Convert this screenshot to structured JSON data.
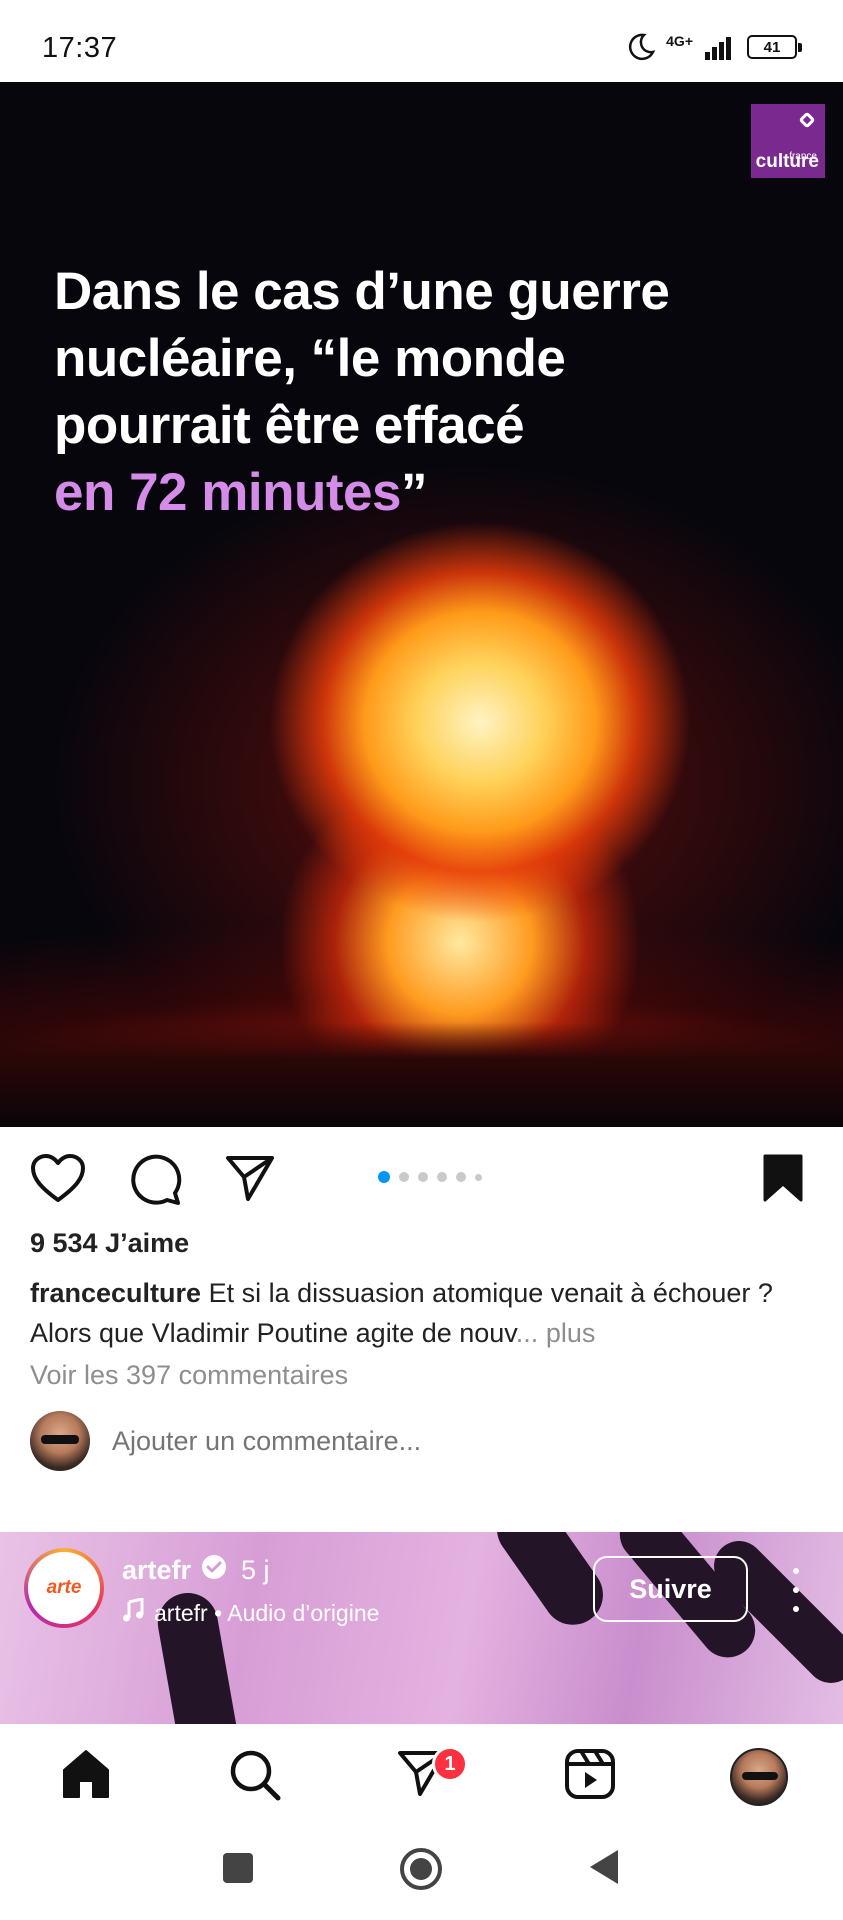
{
  "status_bar": {
    "time": "17:37",
    "network": "4G+",
    "battery": "41"
  },
  "post": {
    "brand_logo": {
      "line1": "france",
      "line2": "culture",
      "color": "#7a2a8e"
    },
    "headline": {
      "line1": "Dans le cas d’une guerre",
      "line2": "nucléaire, “le monde",
      "line3": "pourrait être effacé",
      "accent_line": "en 72 minutes",
      "closing_quote": "”",
      "accent_color": "#d48ce8"
    },
    "likes": "9 534 J’aime",
    "caption": {
      "username": "franceculture",
      "text": "Et si la dissuasion atomique venait à échouer ? Alors que Vladimir Poutine agite de nouv",
      "ellipsis": "...",
      "more": " plus"
    },
    "view_comments": "Voir les 397 commentaires",
    "add_comment_placeholder": "Ajouter un commentaire...",
    "carousel": {
      "total_dots": 6,
      "active_index": 0,
      "active_color": "#0095f6"
    }
  },
  "next_post": {
    "username": "artefr",
    "time": "5 j",
    "audio": "artefr • Audio d’origine",
    "follow_label": "Suivre",
    "avatar_text": "arte"
  },
  "bottom_nav": {
    "messages_badge": "1"
  },
  "icons": {
    "like": "heart-icon",
    "comment": "comment-icon",
    "share": "send-icon",
    "save": "bookmark-icon",
    "home": "home-icon",
    "search": "search-icon",
    "messages": "direct-messages-icon",
    "reels": "reels-icon"
  }
}
